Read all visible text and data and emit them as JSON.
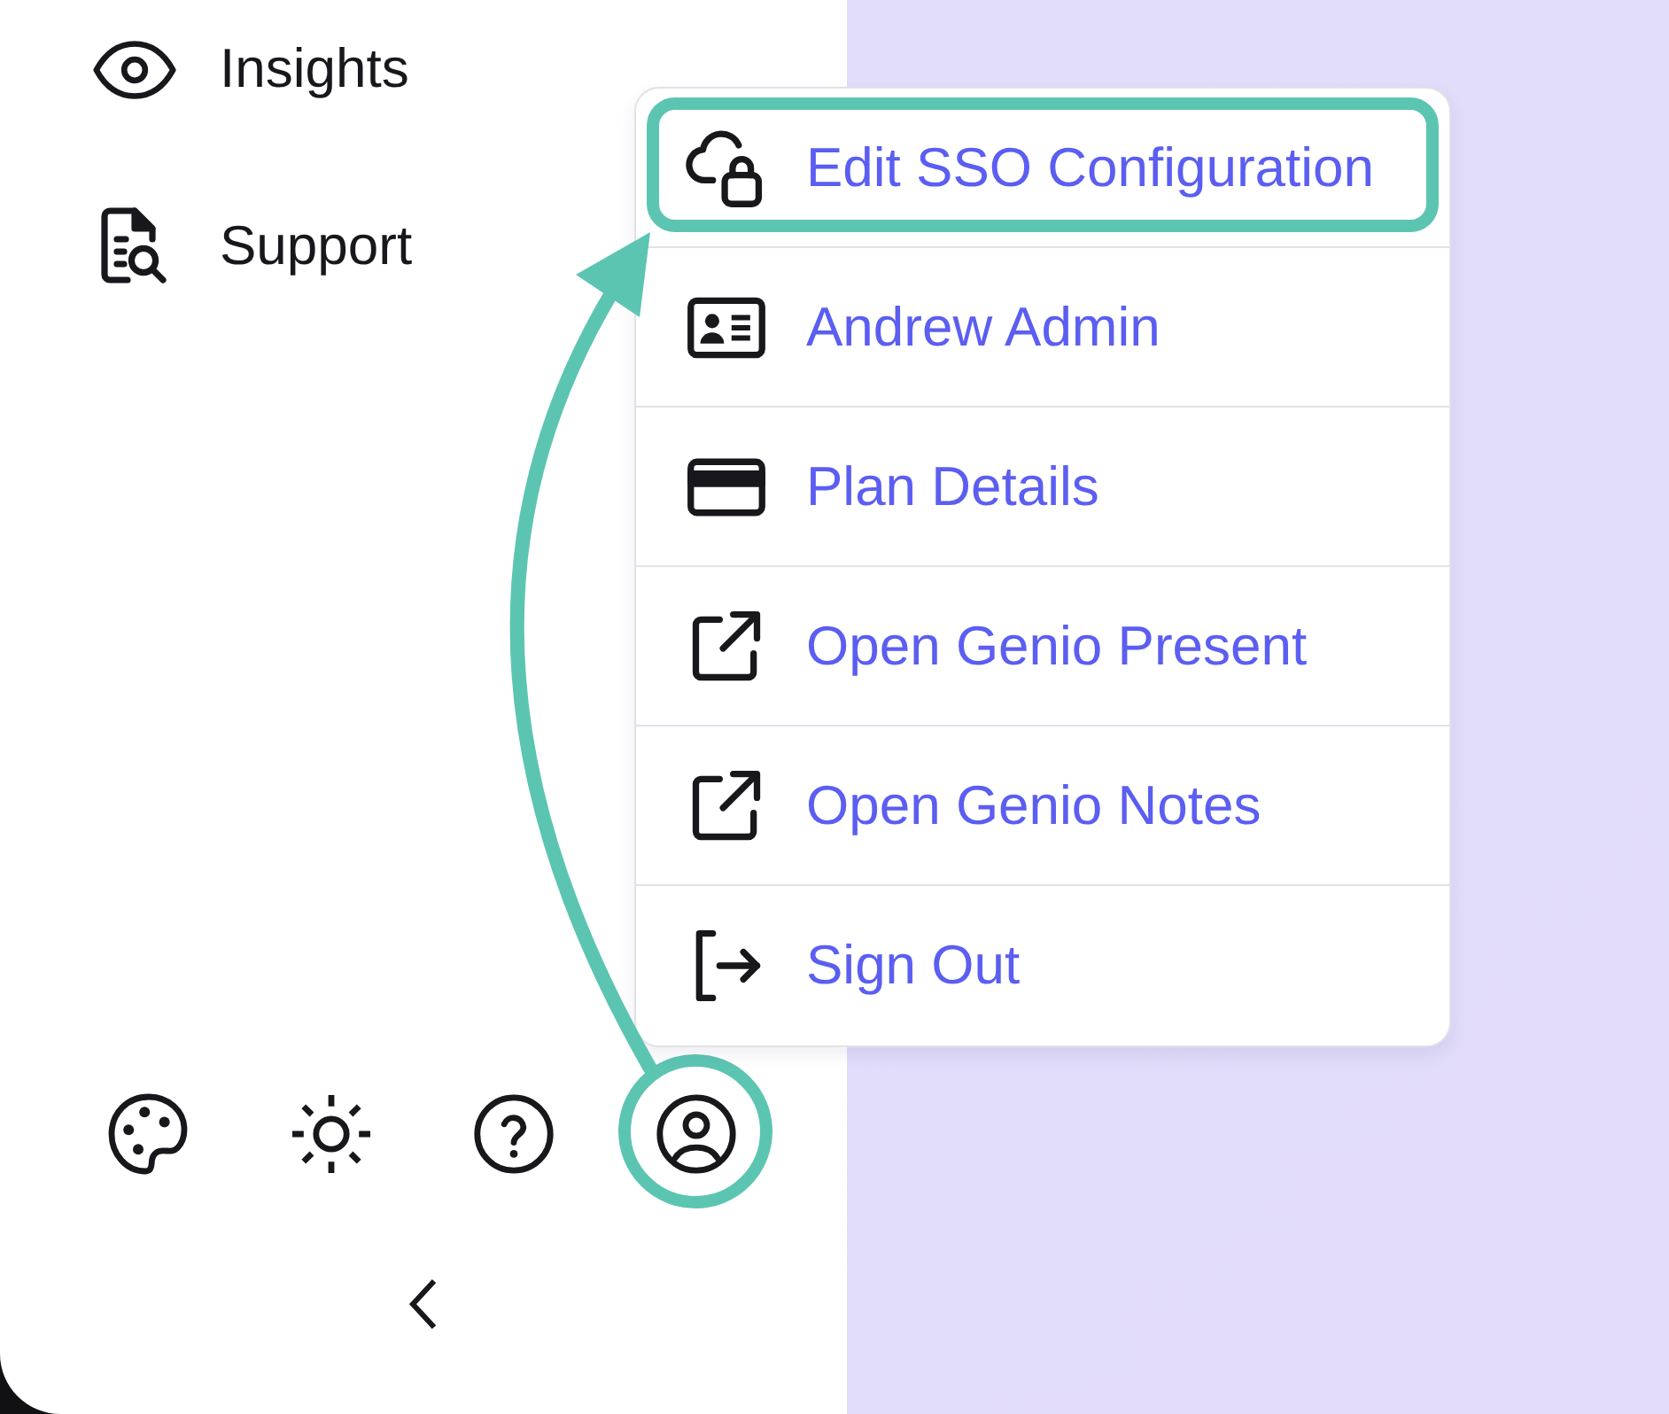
{
  "sidebar": {
    "nav_items": [
      {
        "label": "Insights"
      },
      {
        "label": "Support"
      }
    ],
    "toolbar": [
      {
        "highlighted": false
      },
      {
        "highlighted": false
      },
      {
        "highlighted": false
      },
      {
        "highlighted": true
      }
    ]
  },
  "account_menu": {
    "items": [
      {
        "label": "Edit SSO Configuration",
        "highlighted": true
      },
      {
        "label": "Andrew Admin",
        "highlighted": false
      },
      {
        "label": "Plan Details",
        "highlighted": false
      },
      {
        "label": "Open Genio Present",
        "highlighted": false
      },
      {
        "label": "Open Genio Notes",
        "highlighted": false
      },
      {
        "label": "Sign Out",
        "highlighted": false
      }
    ]
  }
}
